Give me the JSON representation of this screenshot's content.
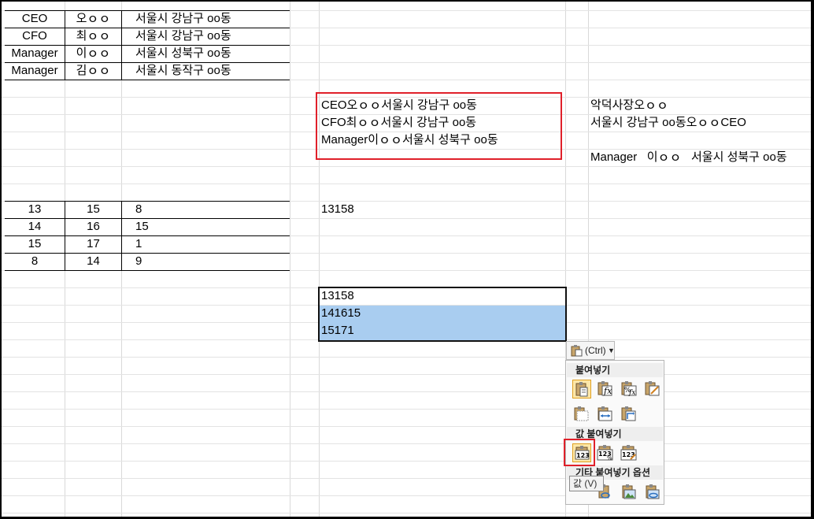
{
  "table1": {
    "rows": [
      [
        "CEO",
        "오ｏｏ",
        "서울시 강남구 oo동"
      ],
      [
        "CFO",
        "최ｏｏ",
        "서울시 강남구 oo동"
      ],
      [
        "Manager",
        "이ｏｏ",
        "서울시 성북구 oo동"
      ],
      [
        "Manager",
        "김ｏｏ",
        "서울시 동작구 oo동"
      ]
    ]
  },
  "concat_results": [
    "CEO오ｏｏ서울시 강남구 oo동",
    "CFO최ｏｏ서울시 강남구 oo동",
    "Manager이ｏｏ서울시 성북구 oo동"
  ],
  "side_texts": [
    "악덕사장오ｏｏ",
    "서울시 강남구 oo동오ｏｏCEO",
    "Manager   이ｏｏ   서울시 성북구 oo동"
  ],
  "table2": {
    "rows": [
      [
        "13",
        "15",
        "8"
      ],
      [
        "14",
        "16",
        "15"
      ],
      [
        "15",
        "17",
        "1"
      ],
      [
        "8",
        "14",
        "9"
      ]
    ]
  },
  "number_concat": "13158",
  "pasted_values": [
    "13158",
    "141615",
    "15171"
  ],
  "paste_options": {
    "button_label": "(Ctrl)",
    "section_paste": "붙여넣기",
    "section_values": "값 붙여넣기",
    "section_other": "기타 붙여넣기 옵션",
    "tooltip": "값 (V)"
  },
  "colors": {
    "highlight_red": "#e0202a",
    "selection_blue": "#a9cdf0",
    "grid": "#d9d9d9"
  }
}
